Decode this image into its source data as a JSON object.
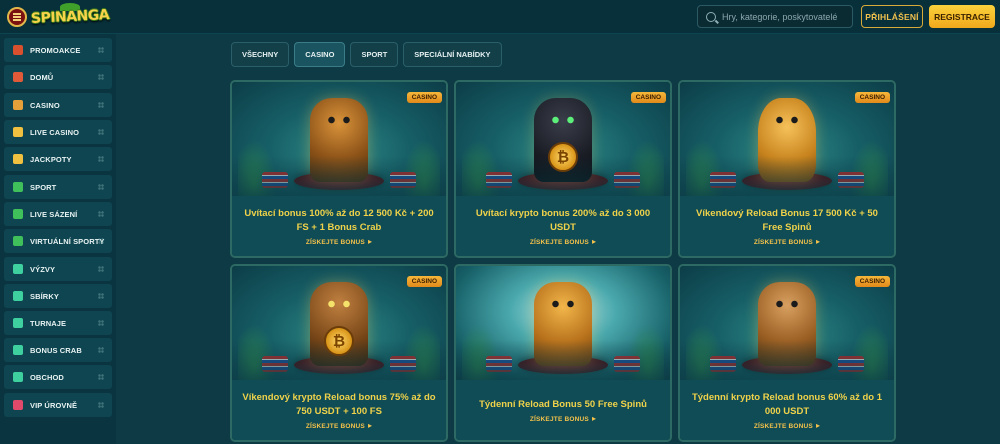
{
  "header": {
    "logo_text": "SPINANGA",
    "search_placeholder": "Hry, kategorie, poskytovatelé",
    "login_label": "PŘIHLÁŠENÍ",
    "register_label": "REGISTRACE"
  },
  "sidebar": {
    "groups": [
      [
        {
          "label": "PROMOAKCE",
          "icon": "gift-icon",
          "color": "#d9502f"
        },
        {
          "label": "DOMŮ",
          "icon": "home-icon",
          "color": "#e05a3a"
        }
      ],
      [
        {
          "label": "CASINO",
          "icon": "slot-icon",
          "color": "#e6a03a"
        },
        {
          "label": "LIVE CASINO",
          "icon": "live-dealer-icon",
          "color": "#f0c040"
        },
        {
          "label": "JACKPOTY",
          "icon": "jackpot-icon",
          "color": "#f0c040"
        }
      ],
      [
        {
          "label": "SPORT",
          "icon": "soccer-ball-icon",
          "color": "#3fc05a"
        },
        {
          "label": "LIVE SÁZENÍ",
          "icon": "live-bet-icon",
          "color": "#3fc05a"
        },
        {
          "label": "VIRTUÁLNÍ SPORTY",
          "icon": "virtual-sports-icon",
          "color": "#3fc05a"
        }
      ],
      [
        {
          "label": "VÝZVY",
          "icon": "challenge-icon",
          "color": "#3fd0a0"
        },
        {
          "label": "SBÍRKY",
          "icon": "collection-icon",
          "color": "#3fd0a0"
        },
        {
          "label": "TURNAJE",
          "icon": "diamond-icon",
          "color": "#3fd0a0"
        },
        {
          "label": "BONUS CRAB",
          "icon": "crab-icon",
          "color": "#3fd0a0"
        },
        {
          "label": "OBCHOD",
          "icon": "shop-icon",
          "color": "#3fd0a0"
        }
      ],
      [
        {
          "label": "VIP ÚROVNĚ",
          "icon": "vip-icon",
          "color": "#e04a6a"
        }
      ]
    ]
  },
  "tabs": [
    {
      "label": "VŠECHNY",
      "active": false
    },
    {
      "label": "CASINO",
      "active": true
    },
    {
      "label": "SPORT",
      "active": false
    },
    {
      "label": "SPECIÁLNÍ NABÍDKY",
      "active": false
    }
  ],
  "cards": [
    {
      "badge": "CASINO",
      "title": "Uvítací bonus 100% až do 12 500 Kč + 200 FS + 1 Bonus Crab",
      "cta": "ZÍSKEJTE BONUS",
      "art": "v-monkey",
      "art_icon": "monkey-idol-icon",
      "coin": ""
    },
    {
      "badge": "CASINO",
      "title": "Uvítací krypto bonus 200% až do 3 000 USDT",
      "cta": "ZÍSKEJTE BONUS",
      "art": "v-panther",
      "art_icon": "panther-bitcoin-icon",
      "coin": "₿"
    },
    {
      "badge": "CASINO",
      "title": "Víkendový Reload Bonus 17 500 Kč + 50 Free Spinů",
      "cta": "ZÍSKEJTE BONUS",
      "art": "v-mask",
      "art_icon": "aztec-mask-icon",
      "coin": ""
    },
    {
      "badge": "CASINO",
      "title": "Víkendový krypto Reload bonus 75% až do 750 USDT + 100 FS",
      "cta": "ZÍSKEJTE BONUS",
      "art": "v-frog",
      "art_icon": "frog-bitcoin-icon",
      "coin": "₿"
    },
    {
      "badge": "",
      "title": "Týdenní Reload Bonus 50 Free Spinů",
      "cta": "ZÍSKEJTE BONUS",
      "art": "v-jaguar",
      "art_icon": "jaguar-mask-icon",
      "coin": ""
    },
    {
      "badge": "CASINO",
      "title": "Týdenní krypto Reload bonus 60% až do 1 000 USDT",
      "cta": "ZÍSKEJTE BONUS",
      "art": "v-sloth",
      "art_icon": "sloth-slot-icon",
      "coin": ""
    }
  ]
}
